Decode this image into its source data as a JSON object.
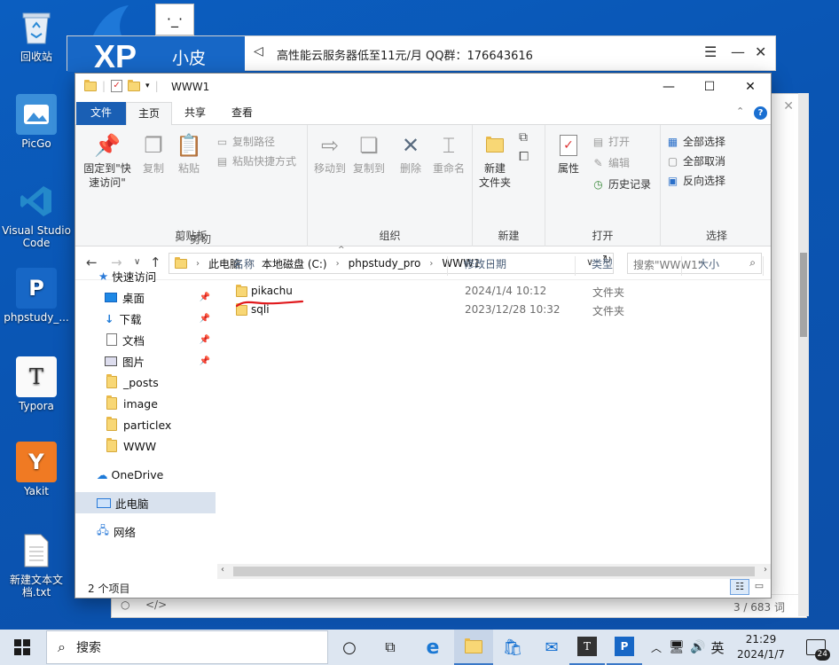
{
  "desktop": {
    "icons": [
      {
        "label": "回收站"
      },
      {
        "label": "PicGo"
      },
      {
        "label": "Visual Studio Code"
      },
      {
        "label": "phpstudy_..."
      },
      {
        "label": "Typora"
      },
      {
        "label": "Yakit"
      },
      {
        "label": "新建文本文档.txt"
      }
    ]
  },
  "background_app": {
    "logo_text": "XP",
    "name": "小皮",
    "announcement": "高性能云服务器低至11元/月  QQ群：176643616",
    "footer_right": "3 / 683 词"
  },
  "explorer": {
    "title": "WWW1",
    "tabs": [
      "文件",
      "主页",
      "共享",
      "查看"
    ],
    "ribbon": {
      "clipboard": {
        "group": "剪贴板",
        "pin": "固定到\"快速访问\"",
        "copy": "复制",
        "paste": "粘贴",
        "copy_path": "复制路径",
        "paste_shortcut": "粘贴快捷方式",
        "cut": "剪切"
      },
      "organize": {
        "group": "组织",
        "move_to": "移动到",
        "copy_to": "复制到",
        "delete": "删除",
        "rename": "重命名"
      },
      "new": {
        "group": "新建",
        "new_folder": "新建\n文件夹"
      },
      "open": {
        "group": "打开",
        "properties": "属性",
        "open": "打开",
        "edit": "编辑",
        "history": "历史记录"
      },
      "select": {
        "group": "选择",
        "select_all": "全部选择",
        "select_none": "全部取消",
        "invert": "反向选择"
      }
    },
    "address": {
      "path": [
        "此电脑",
        "本地磁盘 (C:)",
        "phpstudy_pro",
        "WWW1"
      ],
      "search_placeholder": "搜索\"WWW1\""
    },
    "nav": {
      "quick_access": "快速访问",
      "items": [
        "桌面",
        "下载",
        "文档",
        "图片",
        "_posts",
        "image",
        "particlex",
        "WWW"
      ],
      "onedrive": "OneDrive",
      "this_pc": "此电脑",
      "network": "网络"
    },
    "columns": [
      "名称",
      "修改日期",
      "类型",
      "大小"
    ],
    "files": [
      {
        "name": "pikachu",
        "date": "2024/1/4 10:12",
        "type": "文件夹"
      },
      {
        "name": "sqli",
        "date": "2023/12/28 10:32",
        "type": "文件夹"
      }
    ],
    "status": "2 个项目"
  },
  "taskbar": {
    "search": "搜索",
    "ime": "英",
    "time": "21:29",
    "date": "2024/1/7",
    "notif_count": "24"
  }
}
